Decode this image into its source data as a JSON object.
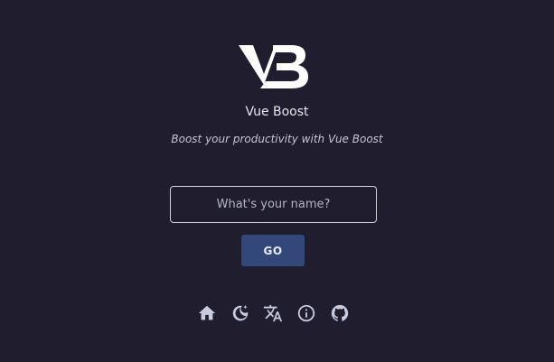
{
  "app": {
    "title": "Vue Boost",
    "tagline": "Boost your productivity with Vue Boost"
  },
  "form": {
    "name_placeholder": "What's your name?",
    "name_value": "",
    "go_label": "GO"
  },
  "toolbar": {
    "icons": [
      "home-icon",
      "theme-toggle-icon",
      "language-icon",
      "info-icon",
      "github-icon"
    ]
  },
  "colors": {
    "background": "#1f1d2e",
    "button": "#34477a",
    "text": "#e6e6ee"
  }
}
